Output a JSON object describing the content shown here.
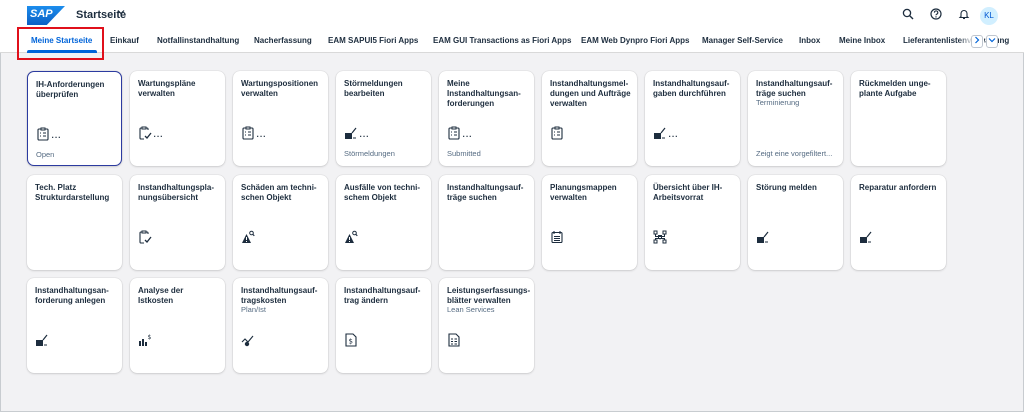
{
  "shell": {
    "logo_text": "SAP",
    "app_title": "Startseite",
    "avatar_initials": "KL"
  },
  "tabs": [
    {
      "label": "Meine Startseite",
      "active": true
    },
    {
      "label": "Einkauf"
    },
    {
      "label": "Notfallinstandhaltung"
    },
    {
      "label": "Nacherfassung"
    },
    {
      "label": "EAM SAPUI5 Fiori Apps"
    },
    {
      "label": "EAM GUI Transactions as Fiori Apps"
    },
    {
      "label": "EAM Web Dynpro Fiori Apps"
    },
    {
      "label": "Manager Self-Service"
    },
    {
      "label": "Inbox"
    },
    {
      "label": "Meine Inbox"
    },
    {
      "label": "Lieferantenlistenverwaltung"
    }
  ],
  "tiles": [
    {
      "title": "IH-Anforderungen überprüfen",
      "icon": "clipboard-tasks-icon",
      "dots": "...",
      "footer": "Open"
    },
    {
      "title": "Wartungspläne verwalten",
      "icon": "clipboard-check-icon",
      "dots": "..."
    },
    {
      "title": "Wartungspositionen verwalten",
      "icon": "clipboard-tasks-icon",
      "dots": "..."
    },
    {
      "title": "Störmeldungen bearbeiten",
      "icon": "edit-note-icon",
      "dots": "...",
      "footer": "Störmeldungen"
    },
    {
      "title": "Meine Instandhaltungsan-forderungen",
      "icon": "clipboard-tasks-icon",
      "dots": "...",
      "footer": "Submitted"
    },
    {
      "title": "Instandhaltungsmel-dungen und Aufträge verwalten",
      "icon": "clipboard-tasks-icon"
    },
    {
      "title": "Instandhaltungsauf-gaben durchführen",
      "icon": "edit-note-icon",
      "dots": "..."
    },
    {
      "title": "Instandhaltungsauf-träge suchen",
      "subtitle": "Terminierung",
      "footer": "Zeigt eine vorgefiltert..."
    },
    {
      "title": "Rückmelden unge-plante Aufgabe"
    },
    {
      "title": "Tech. Platz Strukturdarstellung"
    },
    {
      "title": "Instandhaltungspla-nungsübersicht",
      "icon": "clipboard-check-icon"
    },
    {
      "title": "Schäden am techni-schen Objekt",
      "icon": "warning-search-icon"
    },
    {
      "title": "Ausfälle von techni-schem Objekt",
      "icon": "warning-search-icon"
    },
    {
      "title": "Instandhaltungsauf-träge suchen"
    },
    {
      "title": "Planungsmappen verwalten",
      "icon": "calendar-icon"
    },
    {
      "title": "Übersicht über IH-Arbeitsvorrat",
      "icon": "hierarchy-icon"
    },
    {
      "title": "Störung melden",
      "icon": "edit-note-icon"
    },
    {
      "title": "Reparatur anfordern",
      "icon": "edit-note-icon"
    },
    {
      "title": "Instandhaltungsan-forderung anlegen",
      "icon": "edit-note-icon"
    },
    {
      "title": "Analyse der Istkosten",
      "icon": "bar-chart-dollar-icon"
    },
    {
      "title": "Instandhaltungsauf-tragskosten",
      "subtitle": "Plan/Ist",
      "icon": "trend-cost-icon"
    },
    {
      "title": "Instandhaltungsauf-trag ändern",
      "icon": "document-dollar-icon"
    },
    {
      "title": "Leistungserfassungs-blätter verwalten",
      "subtitle": "Lean Services",
      "icon": "document-list-icon"
    }
  ]
}
